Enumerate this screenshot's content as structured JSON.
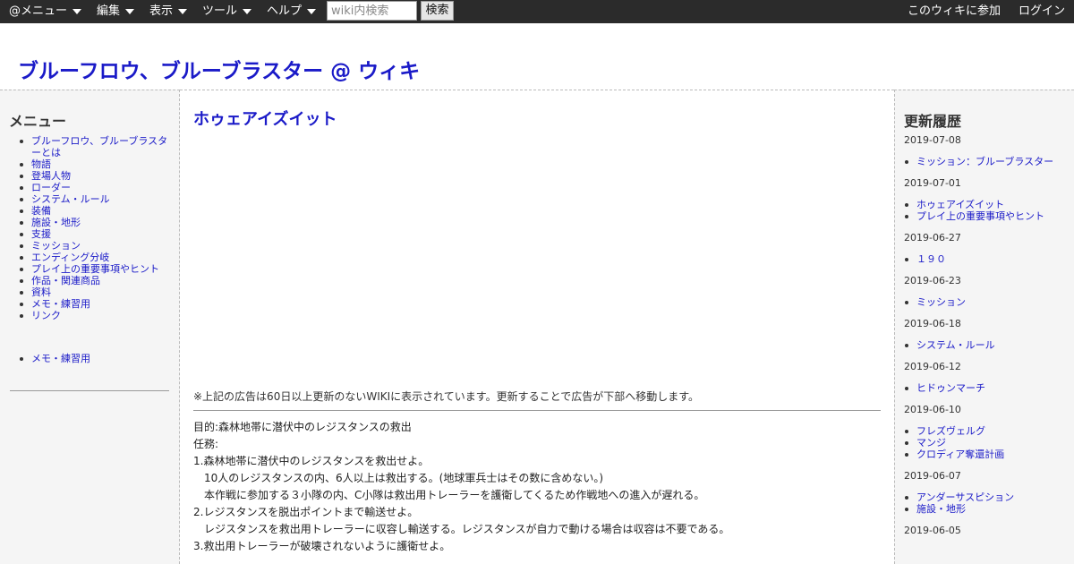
{
  "topbar": {
    "menus": [
      "@メニュー",
      "編集",
      "表示",
      "ツール",
      "ヘルプ"
    ],
    "search_placeholder": "wiki内検索",
    "search_button": "検索",
    "join_label": "このウィキに参加",
    "login_label": "ログイン"
  },
  "site_title": "ブルーフロウ、ブルーブラスター @ ウィキ",
  "left_menu": {
    "heading": "メニュー",
    "items": [
      "ブルーフロウ、ブルーブラスターとは",
      "物語",
      "登場人物",
      "ローダー",
      "システム・ルール",
      "装備",
      "施設・地形",
      "支援",
      "ミッション",
      "エンディング分岐",
      "プレイ上の重要事項やヒント",
      "作品・関連商品",
      "資料",
      "メモ・練習用",
      "リンク"
    ],
    "extra_items": [
      "メモ・練習用"
    ]
  },
  "main": {
    "page_title": "ホゥェアイズイット",
    "ad_notice": "※上記の広告は60日以上更新のないWIKIに表示されています。更新することで広告が下部へ移動します。",
    "lines": [
      "目的:森林地帯に潜伏中のレジスタンスの救出",
      "任務:",
      "1.森林地帯に潜伏中のレジスタンスを救出せよ。",
      "10人のレジスタンスの内、6人以上は救出する。(地球軍兵士はその数に含めない。)",
      "本作戦に参加する３小隊の内、C小隊は救出用トレーラーを護衛してくるため作戦地への進入が遅れる。",
      "2.レジスタンスを脱出ポイントまで輸送せよ。",
      "レジスタンスを救出用トレーラーに収容し輸送する。レジスタンスが自力で動ける場合は収容は不要である。",
      "3.救出用トレーラーが破壊されないように護衛せよ。"
    ]
  },
  "history": {
    "heading": "更新履歴",
    "groups": [
      {
        "date": "2019-07-08",
        "items": [
          "ミッション：ブルーブラスター"
        ]
      },
      {
        "date": "2019-07-01",
        "items": [
          "ホゥェアイズイット",
          "プレイ上の重要事項やヒント"
        ]
      },
      {
        "date": "2019-06-27",
        "items": [
          "１９０"
        ]
      },
      {
        "date": "2019-06-23",
        "items": [
          "ミッション"
        ]
      },
      {
        "date": "2019-06-18",
        "items": [
          "システム・ルール"
        ]
      },
      {
        "date": "2019-06-12",
        "items": [
          "ヒドゥンマーチ"
        ]
      },
      {
        "date": "2019-06-10",
        "items": [
          "フレズヴェルグ",
          "マンジ",
          "クロディア奪還計画"
        ]
      },
      {
        "date": "2019-06-07",
        "items": [
          "アンダーサスピション",
          "施設・地形"
        ]
      },
      {
        "date": "2019-06-05",
        "items": []
      }
    ]
  }
}
